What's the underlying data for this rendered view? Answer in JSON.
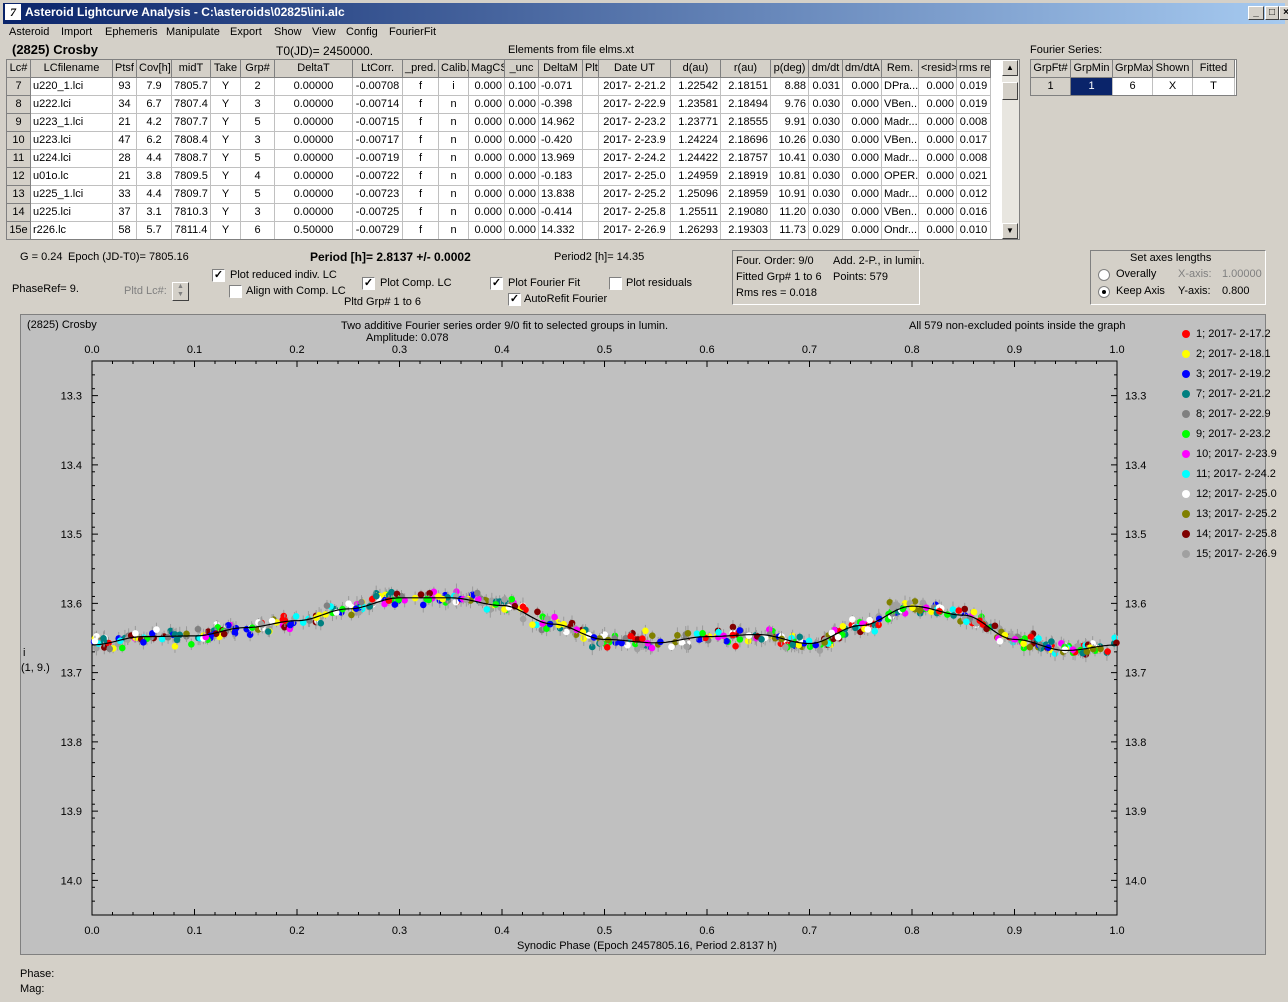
{
  "window": {
    "title": "Asteroid Lightcurve Analysis - C:\\asteroids\\02825\\ini.alc"
  },
  "menu": [
    "Asteroid",
    "Import",
    "Ephemeris",
    "Manipulate",
    "Export",
    "Show",
    "View",
    "Config",
    "FourierFit"
  ],
  "header": {
    "asteroid": "(2825) Crosby",
    "t0": "T0(JD)= 2450000.",
    "elements": "Elements from file elms.xt"
  },
  "lc_table": {
    "columns": [
      "Lc#",
      "LCfilename",
      "Ptsf",
      "Cov[h]",
      "midT",
      "Take",
      "Grp#",
      "DeltaT",
      "LtCorr.",
      "_pred.",
      "Calib.",
      "MagCS",
      "_unc",
      "DeltaM",
      "Plt",
      "Date UT",
      "d(au)",
      "r(au)",
      "p(deg)",
      "dm/dt",
      "dm/dtA",
      "Rem.",
      "<resid>",
      "rms res"
    ],
    "rows": [
      [
        "7",
        "u220_1.lci",
        "93",
        "7.9",
        "7805.7",
        "Y",
        "2",
        "0.00000",
        "-0.00708",
        "f",
        "i",
        "0.000",
        "0.100",
        "-0.071",
        "",
        "2017- 2-21.2",
        "1.22542",
        "2.18151",
        "8.88",
        "0.031",
        "0.000",
        "DPra...",
        "0.000",
        "0.019"
      ],
      [
        "8",
        "u222.lci",
        "34",
        "6.7",
        "7807.4",
        "Y",
        "3",
        "0.00000",
        "-0.00714",
        "f",
        "n",
        "0.000",
        "0.000",
        "-0.398",
        "",
        "2017- 2-22.9",
        "1.23581",
        "2.18494",
        "9.76",
        "0.030",
        "0.000",
        "VBen...",
        "0.000",
        "0.019"
      ],
      [
        "9",
        "u223_1.lci",
        "21",
        "4.2",
        "7807.7",
        "Y",
        "5",
        "0.00000",
        "-0.00715",
        "f",
        "n",
        "0.000",
        "0.000",
        "14.962",
        "",
        "2017- 2-23.2",
        "1.23771",
        "2.18555",
        "9.91",
        "0.030",
        "0.000",
        "Madr...",
        "0.000",
        "0.008"
      ],
      [
        "10",
        "u223.lci",
        "47",
        "6.2",
        "7808.4",
        "Y",
        "3",
        "0.00000",
        "-0.00717",
        "f",
        "n",
        "0.000",
        "0.000",
        "-0.420",
        "",
        "2017- 2-23.9",
        "1.24224",
        "2.18696",
        "10.26",
        "0.030",
        "0.000",
        "VBen...",
        "0.000",
        "0.017"
      ],
      [
        "11",
        "u224.lci",
        "28",
        "4.4",
        "7808.7",
        "Y",
        "5",
        "0.00000",
        "-0.00719",
        "f",
        "n",
        "0.000",
        "0.000",
        "13.969",
        "",
        "2017- 2-24.2",
        "1.24422",
        "2.18757",
        "10.41",
        "0.030",
        "0.000",
        "Madr...",
        "0.000",
        "0.008"
      ],
      [
        "12",
        "u01o.lc",
        "21",
        "3.8",
        "7809.5",
        "Y",
        "4",
        "0.00000",
        "-0.00722",
        "f",
        "n",
        "0.000",
        "0.000",
        "-0.183",
        "",
        "2017- 2-25.0",
        "1.24959",
        "2.18919",
        "10.81",
        "0.030",
        "0.000",
        "OPER...",
        "0.000",
        "0.021"
      ],
      [
        "13",
        "u225_1.lci",
        "33",
        "4.4",
        "7809.7",
        "Y",
        "5",
        "0.00000",
        "-0.00723",
        "f",
        "n",
        "0.000",
        "0.000",
        "13.838",
        "",
        "2017- 2-25.2",
        "1.25096",
        "2.18959",
        "10.91",
        "0.030",
        "0.000",
        "Madr...",
        "0.000",
        "0.012"
      ],
      [
        "14",
        "u225.lci",
        "37",
        "3.1",
        "7810.3",
        "Y",
        "3",
        "0.00000",
        "-0.00725",
        "f",
        "n",
        "0.000",
        "0.000",
        "-0.414",
        "",
        "2017- 2-25.8",
        "1.25511",
        "2.19080",
        "11.20",
        "0.030",
        "0.000",
        "VBen...",
        "0.000",
        "0.016"
      ],
      [
        "15e",
        "r226.lc",
        "58",
        "5.7",
        "7811.4",
        "Y",
        "6",
        "0.50000",
        "-0.00729",
        "f",
        "n",
        "0.000",
        "0.000",
        "14.332",
        "",
        "2017- 2-26.9",
        "1.26293",
        "2.19303",
        "11.73",
        "0.029",
        "0.000",
        "Ondr...",
        "0.000",
        "0.010"
      ]
    ]
  },
  "fourier_series": {
    "label": "Fourier Series:",
    "columns": [
      "GrpFt#",
      "GrpMin",
      "GrpMax",
      "Shown",
      "Fitted"
    ],
    "row": [
      "1",
      "1",
      "6",
      "X",
      "T"
    ]
  },
  "params": {
    "g": "G = 0.24",
    "epoch": "Epoch (JD-T0)= 7805.16",
    "period": "Period [h]= 2.8137 +/- 0.0002",
    "period2": "Period2 [h]= 14.35",
    "phase_ref": "PhaseRef= 9.",
    "pltd_lc": "Pltd Lc#:",
    "pltd_grp": "Pltd Grp#  1   to   6"
  },
  "checkboxes": {
    "plot_reduced": {
      "label": "Plot reduced indiv. LC",
      "checked": "✓"
    },
    "align_comp": {
      "label": "Align with Comp. LC",
      "checked": ""
    },
    "plot_comp": {
      "label": "Plot Comp. LC",
      "checked": "✓"
    },
    "plot_fourier": {
      "label": "Plot Fourier Fit",
      "checked": "✓"
    },
    "autorefit": {
      "label": "AutoRefit Fourier",
      "checked": "✓"
    },
    "plot_residuals": {
      "label": "Plot residuals",
      "checked": ""
    }
  },
  "fourier_info": {
    "order": "Four. Order:  9/0",
    "add": "Add. 2-P., in lumin.",
    "fitted": "Fitted Grp# 1 to 6",
    "points": "Points: 579",
    "rms": "Rms res      = 0.018"
  },
  "axes_box": {
    "title": "Set axes lengths",
    "overally": "Overally",
    "keep_axis": "Keep Axis",
    "x_axis": "X-axis:",
    "x_val": "1.00000",
    "y_axis": "Y-axis:",
    "y_val": "0.800"
  },
  "plot": {
    "name": "(2825) Crosby",
    "subtitle": "Two additive Fourier series order 9/0 fit to selected groups in lumin.",
    "amplitude": "Amplitude: 0.078",
    "points_note": "All 579 non-excluded points inside the graph",
    "ylabel1": "i",
    "ylabel2": "(1, 9.)",
    "xlabel": "Synodic Phase (Epoch 2457805.16, Period 2.8137 h)"
  },
  "chart_data": {
    "type": "scatter",
    "x_ticks": [
      "0.0",
      "0.1",
      "0.2",
      "0.3",
      "0.4",
      "0.5",
      "0.6",
      "0.7",
      "0.8",
      "0.9",
      "1.0"
    ],
    "y_ticks": [
      "13.3",
      "13.4",
      "13.5",
      "13.6",
      "13.7",
      "13.8",
      "13.9",
      "14.0"
    ],
    "xlim": [
      0,
      1
    ],
    "ylim": [
      13.25,
      14.05
    ],
    "y_inverted": true,
    "fit_curve": {
      "x": [
        0.0,
        0.05,
        0.1,
        0.15,
        0.2,
        0.25,
        0.3,
        0.35,
        0.4,
        0.45,
        0.5,
        0.55,
        0.6,
        0.65,
        0.7,
        0.75,
        0.8,
        0.85,
        0.9,
        0.95,
        1.0
      ],
      "y": [
        13.66,
        13.648,
        13.647,
        13.635,
        13.625,
        13.608,
        13.592,
        13.592,
        13.603,
        13.63,
        13.652,
        13.657,
        13.648,
        13.645,
        13.658,
        13.632,
        13.604,
        13.617,
        13.652,
        13.668,
        13.66
      ]
    },
    "series": [
      {
        "name": "1; 2017- 2-17.2",
        "color": "#ff0000"
      },
      {
        "name": "2; 2017- 2-18.1",
        "color": "#ffff00"
      },
      {
        "name": "3; 2017- 2-19.2",
        "color": "#0000ff"
      },
      {
        "name": "7; 2017- 2-21.2",
        "color": "#008080"
      },
      {
        "name": "8; 2017- 2-22.9",
        "color": "#808080"
      },
      {
        "name": "9; 2017- 2-23.2",
        "color": "#00ff00"
      },
      {
        "name": "10; 2017- 2-23.9",
        "color": "#ff00ff"
      },
      {
        "name": "11; 2017- 2-24.2",
        "color": "#00ffff"
      },
      {
        "name": "12; 2017- 2-25.0",
        "color": "#ffffff"
      },
      {
        "name": "13; 2017- 2-25.2",
        "color": "#808000"
      },
      {
        "name": "14; 2017- 2-25.8",
        "color": "#800000"
      },
      {
        "name": "15; 2017- 2-26.9",
        "color": "#a0a0a0"
      }
    ],
    "points_shown": 579
  },
  "status": {
    "phase": "Phase:",
    "mag": "Mag:"
  }
}
